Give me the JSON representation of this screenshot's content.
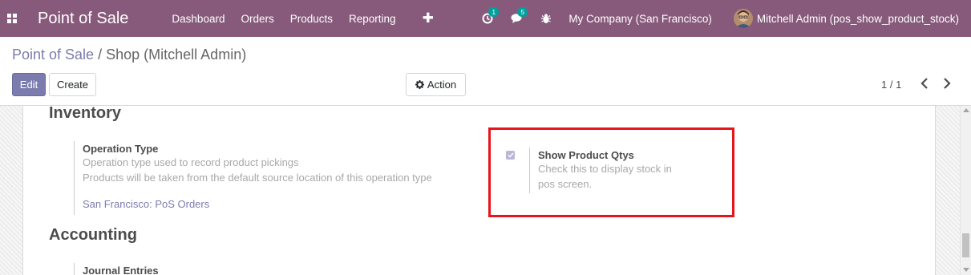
{
  "navbar": {
    "app_title": "Point of Sale",
    "menu": [
      "Dashboard",
      "Orders",
      "Products",
      "Reporting"
    ],
    "plus_icon": "plus-icon",
    "activity_count": "1",
    "messages_count": "5",
    "company": "My Company (San Francisco)",
    "user": "Mitchell Admin (pos_show_product_stock)",
    "brand_color": "#875a7b"
  },
  "control_panel": {
    "breadcrumb_parent": "Point of Sale",
    "breadcrumb_separator": "/",
    "breadcrumb_current": "Shop (Mitchell Admin)",
    "edit_label": "Edit",
    "create_label": "Create",
    "action_label": "Action",
    "pager": "1 / 1"
  },
  "inventory": {
    "title": "Inventory",
    "operation_type": {
      "label": "Operation Type",
      "help1": "Operation type used to record product pickings",
      "help2": "Products will be taken from the default source location of this operation type",
      "value": "San Francisco: PoS Orders"
    },
    "show_product_qtys": {
      "label": "Show Product Qtys",
      "help_line1": "Check this to display stock in",
      "help_line2": "pos screen.",
      "checked": true
    }
  },
  "accounting": {
    "title": "Accounting",
    "journal_entries_label": "Journal Entries"
  },
  "colors": {
    "accent": "#7c7bad",
    "highlight": "#e8141b"
  }
}
